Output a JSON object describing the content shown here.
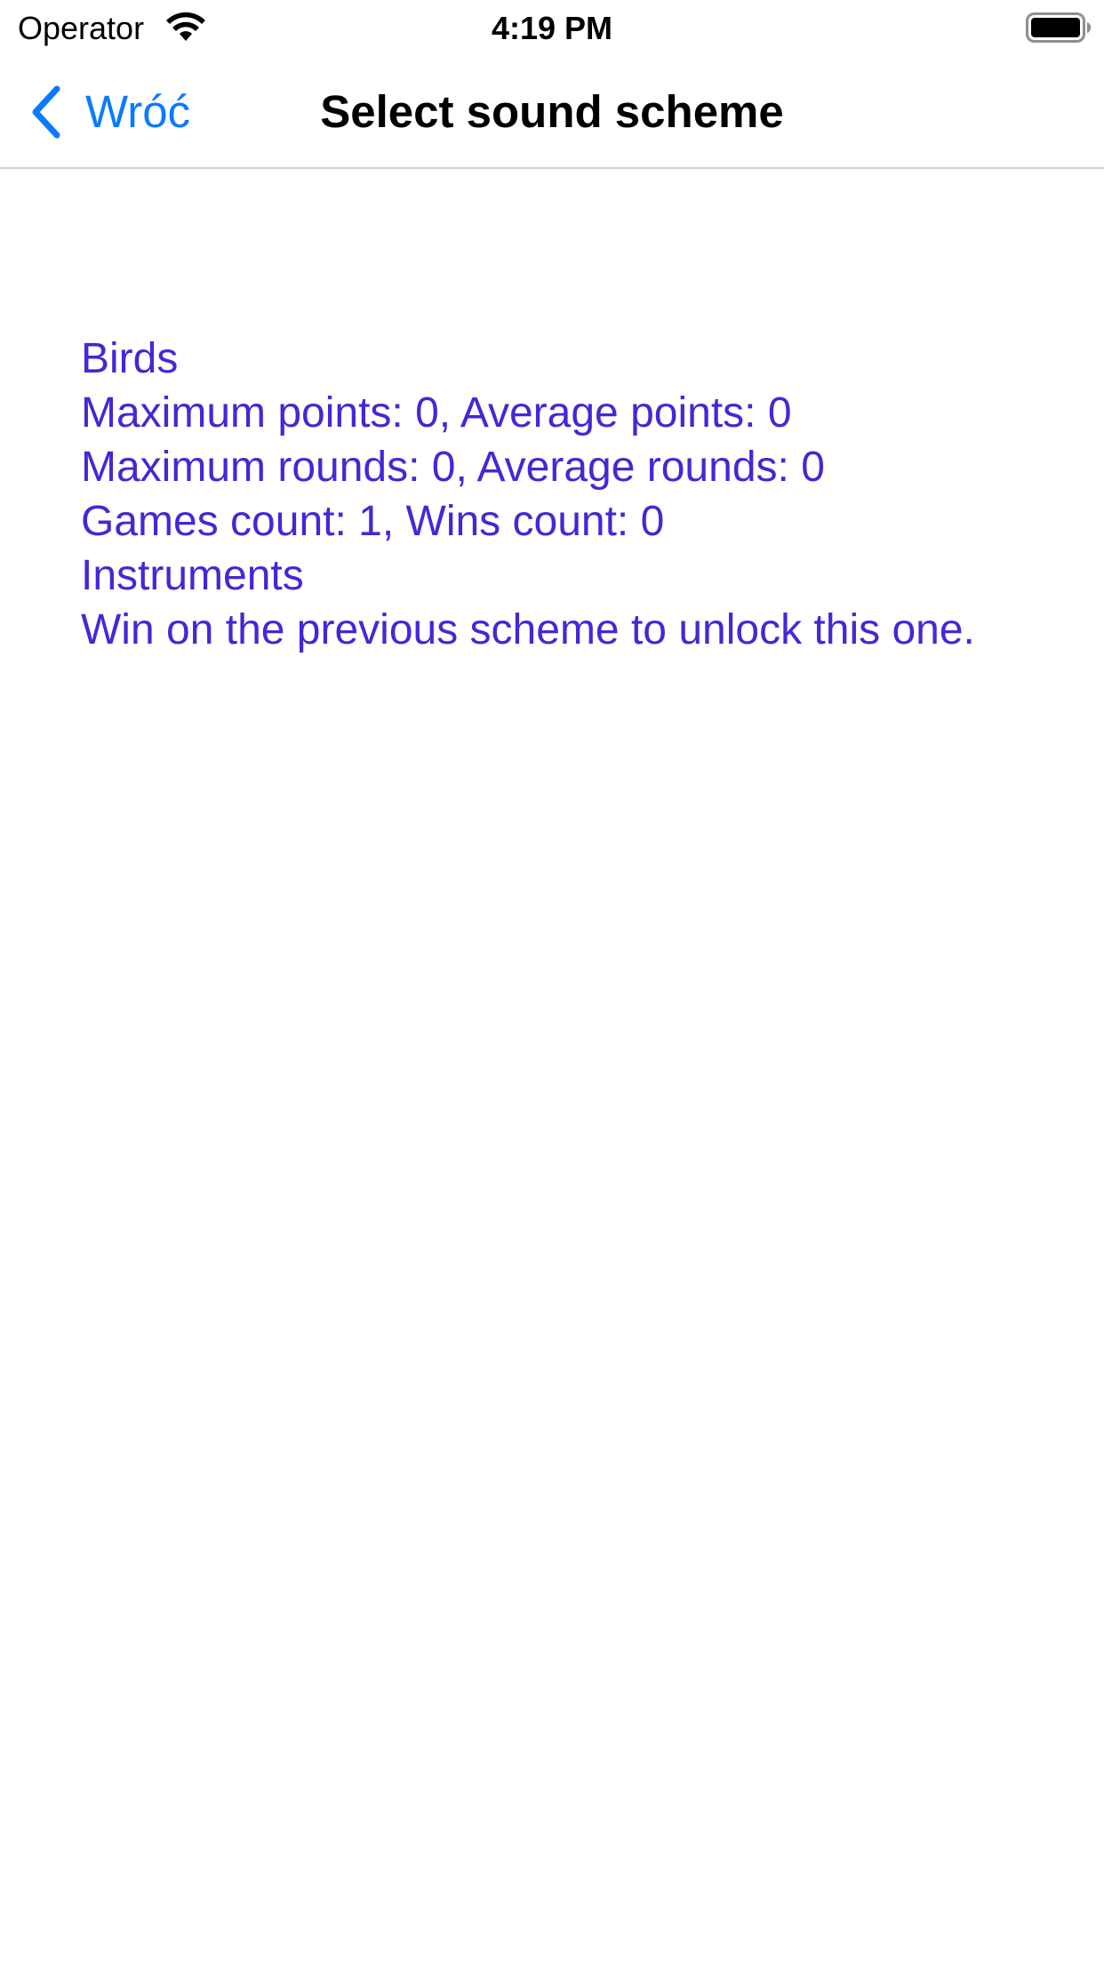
{
  "status_bar": {
    "carrier": "Operator",
    "time": "4:19 PM"
  },
  "nav": {
    "back_label": "Wróć",
    "title": "Select sound scheme"
  },
  "schemes": [
    {
      "name": "Birds",
      "max_points_line": "Maximum points: 0, Average points: 0",
      "max_rounds_line": "Maximum rounds: 0, Average rounds: 0",
      "games_line": "Games count: 1, Wins count: 0"
    },
    {
      "name": "Instruments",
      "lock_message": "Win on the previous scheme to unlock this one."
    }
  ],
  "colors": {
    "accent": "#0a7aff",
    "scheme_text": "#4527d6"
  }
}
